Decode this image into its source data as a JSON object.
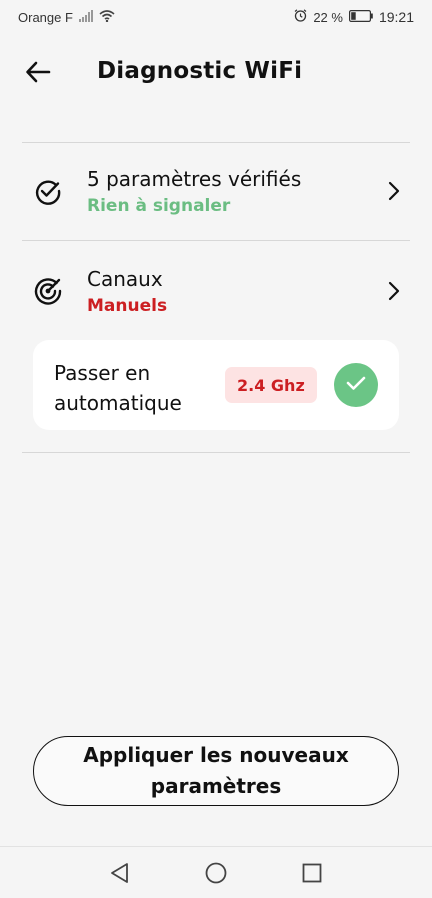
{
  "status_bar": {
    "carrier": "Orange F",
    "battery_percent": "22 %",
    "time": "19:21"
  },
  "header": {
    "title": "Diagnostic WiFi"
  },
  "rows": [
    {
      "title": "5 paramètres vérifiés",
      "subtitle": "Rien à signaler",
      "subtitle_color": "#6bbd82",
      "icon": "check-circle-icon"
    },
    {
      "title": "Canaux",
      "subtitle": "Manuels",
      "subtitle_color": "#cc1f22",
      "icon": "radar-icon"
    }
  ],
  "card": {
    "label": "Passer en automatique",
    "badge": "2.4 Ghz",
    "badge_color": "#cc1f22",
    "check_color": "#6bc586"
  },
  "apply_button": {
    "label": "Appliquer les nouveaux paramètres"
  },
  "nav": {
    "buttons": [
      "back-triangle-icon",
      "home-circle-icon",
      "recents-square-icon"
    ]
  }
}
